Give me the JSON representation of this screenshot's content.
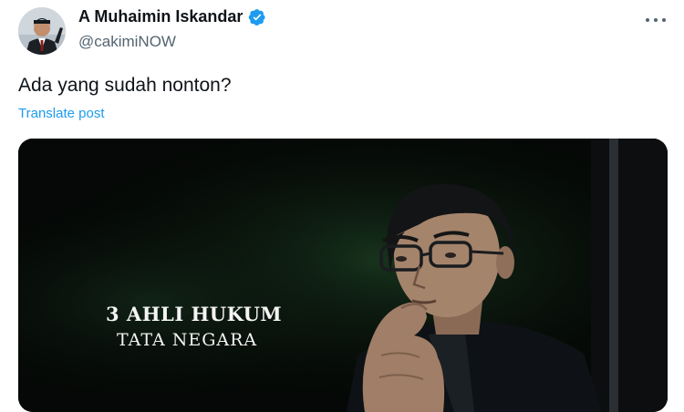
{
  "author": {
    "display_name": "A Muhaimin Iskandar",
    "handle": "@cakimiNOW",
    "verified": true,
    "avatar": "profile-photo"
  },
  "post": {
    "text": "Ada yang sudah nonton?",
    "translate_label": "Translate post"
  },
  "media": {
    "overlay_line1": "3 AHLI HUKUM",
    "overlay_line2": "TATA NEGARA"
  },
  "colors": {
    "text_primary": "#0f1419",
    "text_secondary": "#536471",
    "link": "#1d9bf0",
    "verified_badge": "#1d9bf0",
    "media_background": "#050806"
  },
  "icons": {
    "verified": "verified-badge-icon",
    "more": "more-options-icon"
  }
}
